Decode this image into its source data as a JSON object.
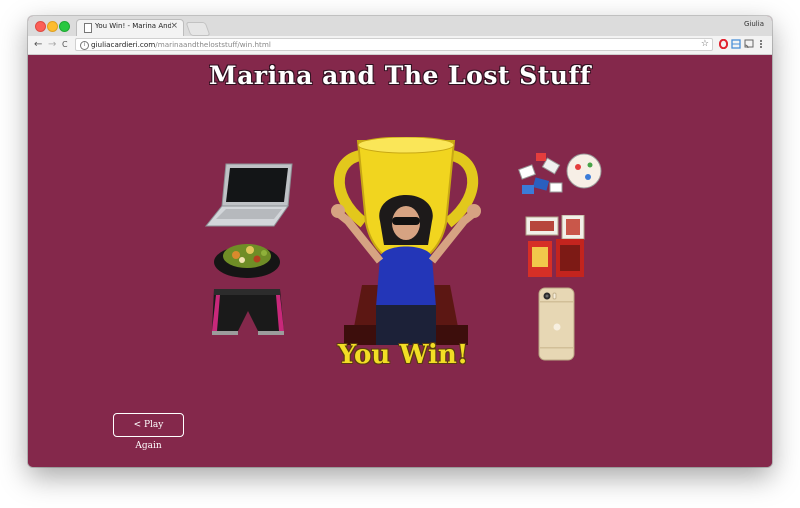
{
  "browser": {
    "tab_title": "You Win! - Marina And The",
    "tab_close": "×",
    "profile_name": "Giulia",
    "url_host": "giuliacardieri.com",
    "url_path": "/marinaandtheloststuff/win.html",
    "star": "☆"
  },
  "nav": {
    "back": "←",
    "forward": "→",
    "reload": "C"
  },
  "page": {
    "title": "Marina and The Lost Stuff",
    "win_text": "You Win!",
    "play_again_label": "< Play Again"
  },
  "colors": {
    "background": "#84284b",
    "title_text": "#ffffff",
    "win_text": "#f2de25",
    "trophy_gold": "#f1d51f"
  },
  "icons": [
    "document-icon",
    "info-icon",
    "star-icon",
    "opera-icon",
    "extension-icon",
    "cast-icon",
    "menu-icon"
  ]
}
